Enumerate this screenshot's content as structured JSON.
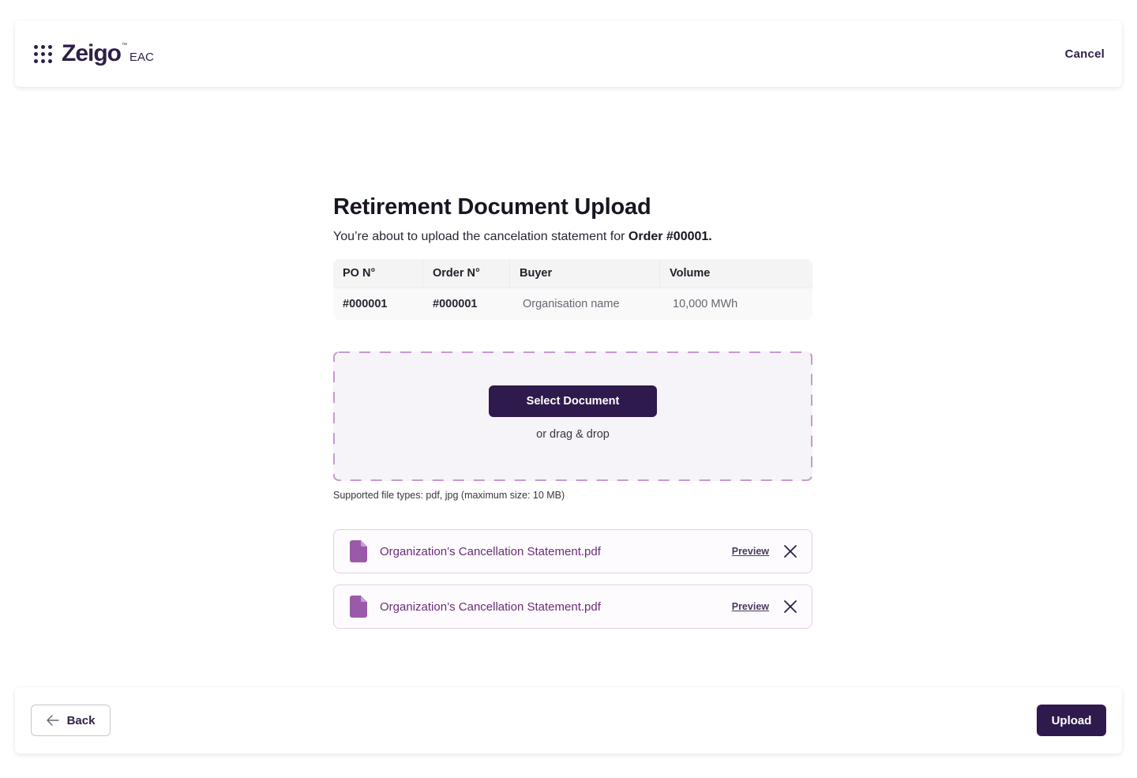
{
  "header": {
    "logo_word": "Zeigo",
    "logo_tm": "™",
    "logo_suffix": "EAC",
    "cancel_label": "Cancel"
  },
  "main": {
    "title": "Retirement Document Upload",
    "subtitle_prefix": "You’re about to upload the cancelation statement for ",
    "subtitle_order": "Order #00001.",
    "table": {
      "headers": [
        "PO N°",
        "Order N°",
        "Buyer",
        "Volume"
      ],
      "row": [
        "#000001",
        "#000001",
        "Organisation name",
        "10,000 MWh"
      ]
    },
    "dropzone": {
      "select_label": "Select Document",
      "drag_text": "or drag & drop",
      "help_text": "Supported file types: pdf, jpg (maximum size: 10 MB)"
    },
    "files": [
      {
        "name": "Organization’s Cancellation Statement.pdf",
        "preview_label": "Preview"
      },
      {
        "name": "Organization’s Cancellation Statement.pdf",
        "preview_label": "Preview"
      }
    ]
  },
  "footer": {
    "back_label": "Back",
    "upload_label": "Upload"
  },
  "colors": {
    "brand": "#2e1f47",
    "primary_button": "#2e1a4c",
    "file_accent": "#9b5aa9",
    "dropzone_border": "#c69ad0"
  },
  "icons": {
    "app_grid": "grid-dots-icon",
    "file": "document-icon",
    "remove": "close-icon",
    "back": "arrow-left-icon"
  }
}
